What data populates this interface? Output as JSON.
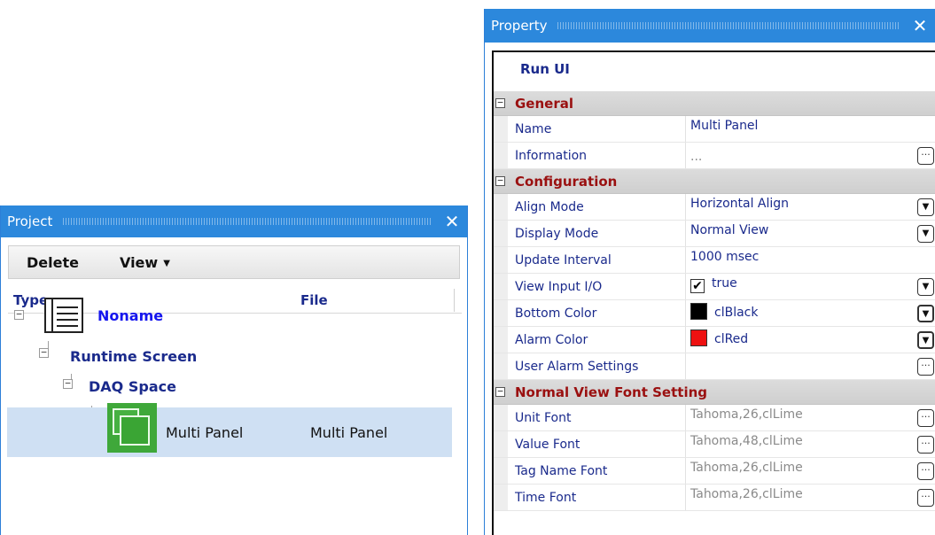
{
  "project_panel": {
    "title": "Project",
    "close_glyph": "✕",
    "toolbar": {
      "delete_label": "Delete",
      "view_label": "View"
    },
    "columns": {
      "type": "Type",
      "file": "File"
    },
    "tree": {
      "root": {
        "label": "Noname",
        "icon": "list-document-icon"
      },
      "runtime_screen": {
        "label": "Runtime Screen"
      },
      "daq_space": {
        "label": "DAQ Space"
      },
      "multi_panel": {
        "label": "Multi Panel",
        "file": "Multi Panel",
        "icon": "multi-panel-icon"
      }
    }
  },
  "property_panel": {
    "title": "Property",
    "close_glyph": "✕",
    "object_name": "Run UI",
    "categories": {
      "general": {
        "label": "General",
        "rows": {
          "name": {
            "label": "Name",
            "value": "Multi Panel"
          },
          "information": {
            "label": "Information",
            "value": "..."
          }
        }
      },
      "configuration": {
        "label": "Configuration",
        "rows": {
          "align_mode": {
            "label": "Align Mode",
            "value": "Horizontal Align"
          },
          "display_mode": {
            "label": "Display Mode",
            "value": "Normal View"
          },
          "update_interval": {
            "label": "Update Interval",
            "value": "1000 msec"
          },
          "view_input_io": {
            "label": "View Input I/O",
            "value": "true",
            "checked": true
          },
          "bottom_color": {
            "label": "Bottom Color",
            "value": "clBlack",
            "color": "#000000"
          },
          "alarm_color": {
            "label": "Alarm Color",
            "value": "clRed",
            "color": "#ee1111"
          },
          "user_alarm_settings": {
            "label": "User Alarm Settings",
            "value": ""
          }
        }
      },
      "font_setting": {
        "label": "Normal View Font Setting",
        "rows": {
          "unit_font": {
            "label": "Unit Font",
            "value": "Tahoma,26,clLime"
          },
          "value_font": {
            "label": "Value Font",
            "value": "Tahoma,48,clLime"
          },
          "tag_name_font": {
            "label": "Tag Name Font",
            "value": "Tahoma,26,clLime"
          },
          "time_font": {
            "label": "Time Font",
            "value": "Tahoma,26,clLime"
          }
        }
      }
    }
  },
  "colors": {
    "titlebar": "#2c88dc",
    "category_text": "#9a1010",
    "label_text": "#1a2a8c",
    "selection": "#cfe0f3"
  }
}
